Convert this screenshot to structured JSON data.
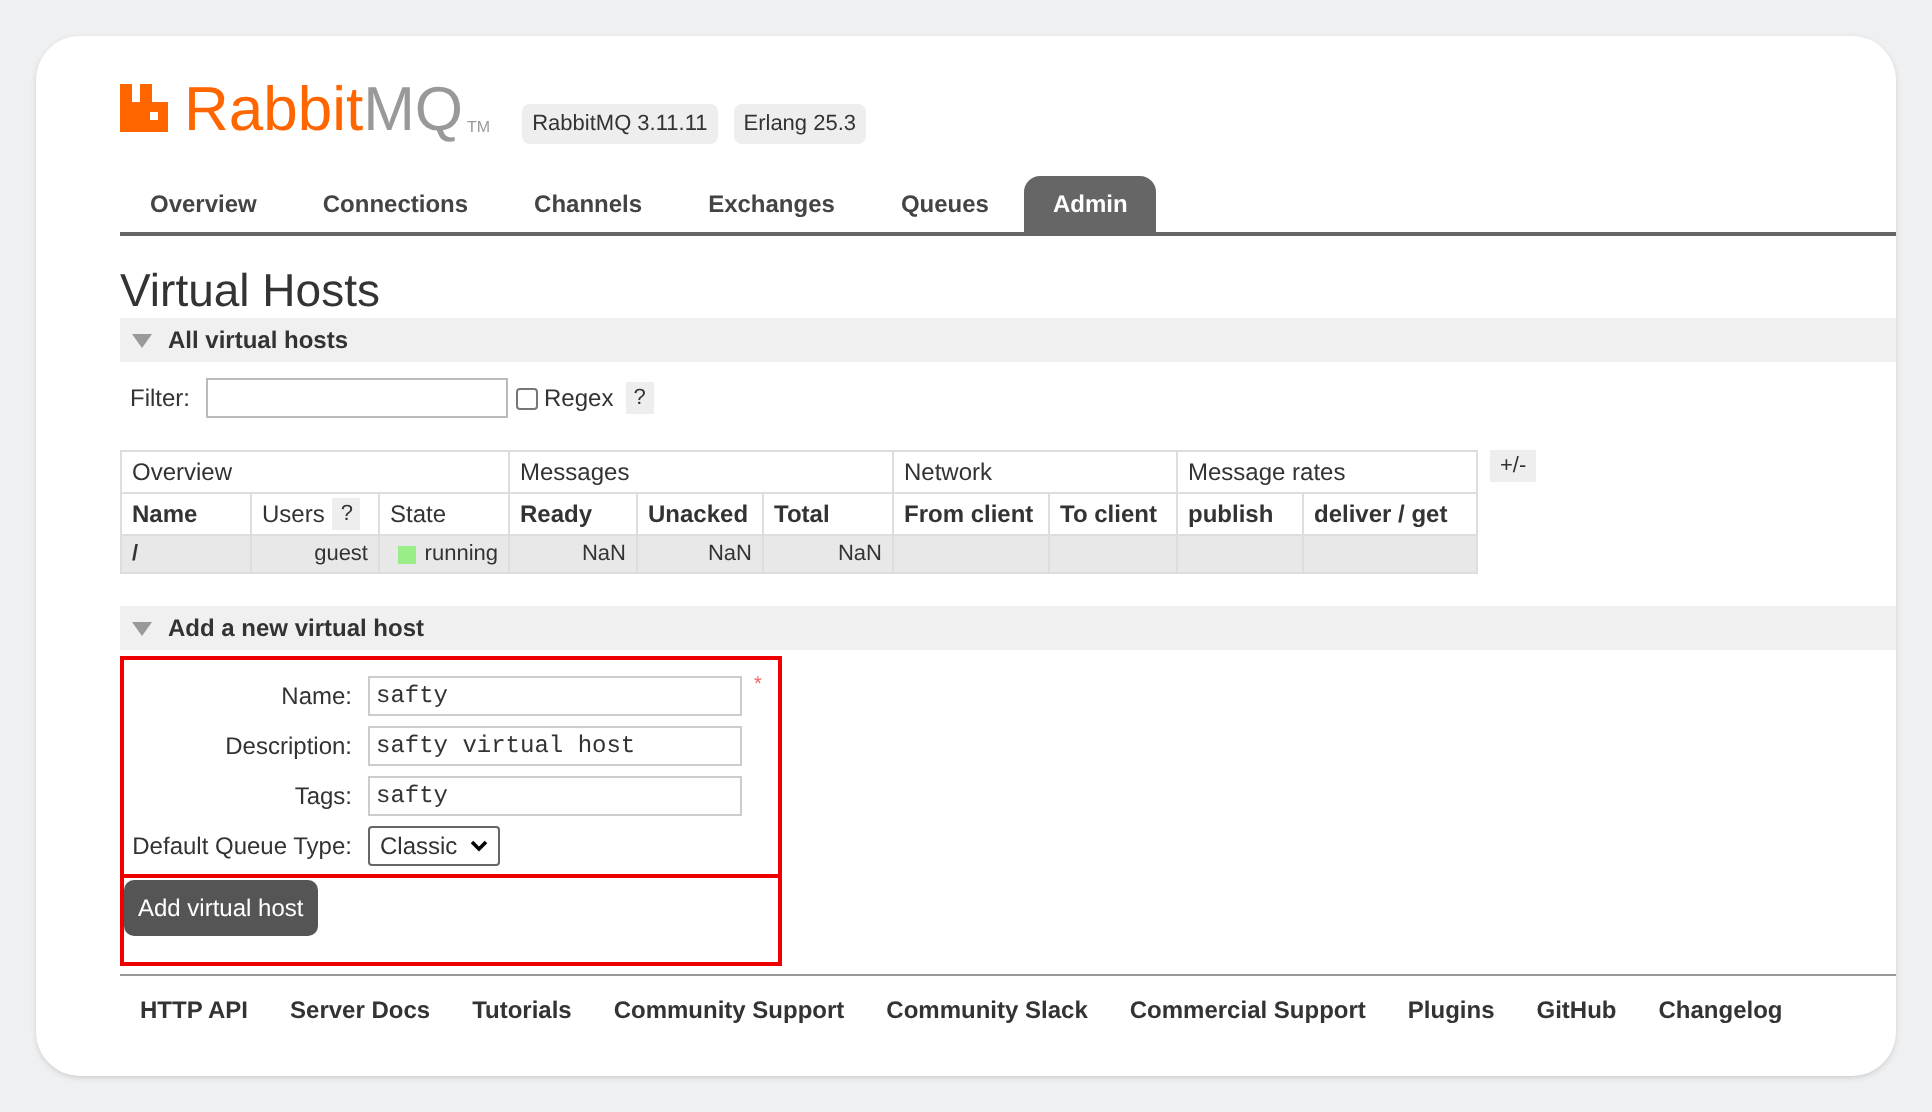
{
  "logo": {
    "brand": "Rabbit",
    "suffix": "MQ",
    "mark": "TM"
  },
  "versions": [
    "RabbitMQ 3.11.11",
    "Erlang 25.3"
  ],
  "tabs": [
    {
      "label": "Overview",
      "selected": false
    },
    {
      "label": "Connections",
      "selected": false
    },
    {
      "label": "Channels",
      "selected": false
    },
    {
      "label": "Exchanges",
      "selected": false
    },
    {
      "label": "Queues",
      "selected": false
    },
    {
      "label": "Admin",
      "selected": true
    }
  ],
  "page_title": "Virtual Hosts",
  "all_section": {
    "title": "All virtual hosts",
    "expanded": true,
    "filter_label": "Filter:",
    "regex_label": "Regex",
    "regex_checked": false,
    "help": "?"
  },
  "table": {
    "groups": [
      {
        "label": "Overview"
      },
      {
        "label": "Messages"
      },
      {
        "label": "Network"
      },
      {
        "label": "Message rates"
      }
    ],
    "columns": [
      {
        "label": "Name",
        "bold": true
      },
      {
        "label": "Users",
        "bold": false,
        "help": "?"
      },
      {
        "label": "State",
        "bold": false
      },
      {
        "label": "Ready",
        "bold": true
      },
      {
        "label": "Unacked",
        "bold": true
      },
      {
        "label": "Total",
        "bold": true
      },
      {
        "label": "From client",
        "bold": true
      },
      {
        "label": "To client",
        "bold": true
      },
      {
        "label": "publish",
        "bold": true
      },
      {
        "label": "deliver / get",
        "bold": true
      }
    ],
    "rows": [
      {
        "cells": [
          "/",
          "guest",
          "running",
          "NaN",
          "NaN",
          "NaN",
          "",
          "",
          "",
          ""
        ],
        "color": "#99ee88"
      }
    ],
    "toggle": "+/-"
  },
  "add_section": {
    "title": "Add a new virtual host",
    "expanded": true,
    "fields": [
      {
        "kind": "text",
        "label": "Name:",
        "value": "safty",
        "required_mark": "*"
      },
      {
        "kind": "text",
        "label": "Description:",
        "value": "safty virtual host"
      },
      {
        "kind": "text",
        "label": "Tags:",
        "value": "safty"
      },
      {
        "kind": "select",
        "label": "Default Queue Type:",
        "value": "Classic"
      }
    ],
    "button": "Add virtual host"
  },
  "footer_links": [
    "HTTP API",
    "Server Docs",
    "Tutorials",
    "Community Support",
    "Community Slack",
    "Commercial Support",
    "Plugins",
    "GitHub",
    "Changelog"
  ]
}
